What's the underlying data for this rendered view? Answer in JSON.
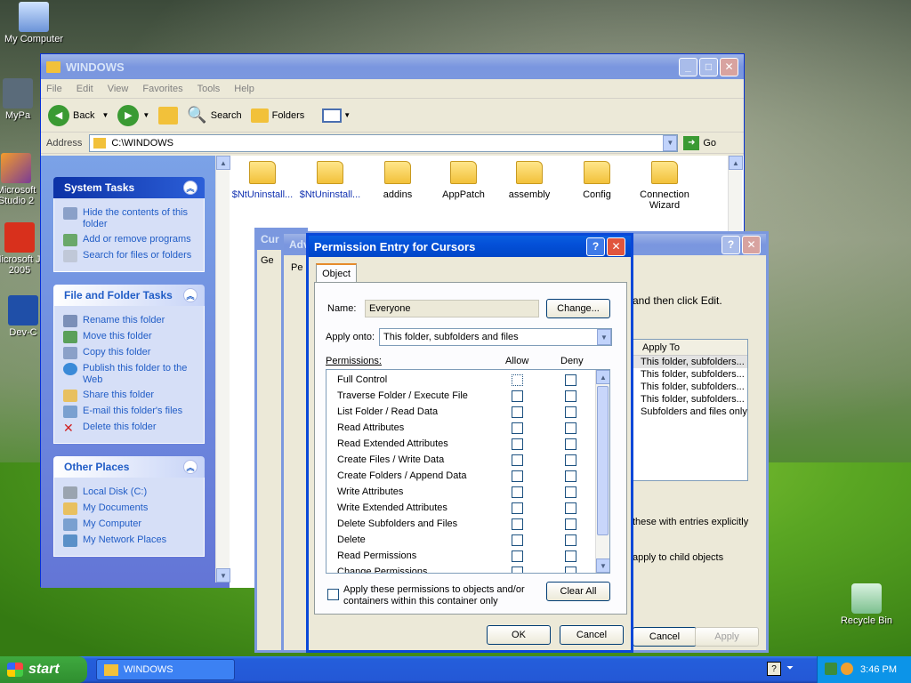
{
  "desktop": {
    "icons": [
      {
        "label": "My Computer"
      },
      {
        "label": "MyPa"
      },
      {
        "label": "Microsoft Studio 2"
      },
      {
        "label": "Microsoft J# 2005"
      },
      {
        "label": "Dev-C"
      },
      {
        "label": "Recycle Bin"
      }
    ]
  },
  "explorer": {
    "title": "WINDOWS",
    "menu": [
      "File",
      "Edit",
      "View",
      "Favorites",
      "Tools",
      "Help"
    ],
    "toolbar": {
      "back": "Back",
      "search": "Search",
      "folders": "Folders"
    },
    "address": {
      "label": "Address",
      "value": "C:\\WINDOWS",
      "go": "Go"
    },
    "system_tasks": {
      "title": "System Tasks",
      "items": [
        "Hide the contents of this folder",
        "Add or remove programs",
        "Search for files or folders"
      ]
    },
    "file_tasks": {
      "title": "File and Folder Tasks",
      "items": [
        "Rename this folder",
        "Move this folder",
        "Copy this folder",
        "Publish this folder to the Web",
        "Share this folder",
        "E-mail this folder's files",
        "Delete this folder"
      ]
    },
    "other_places": {
      "title": "Other Places",
      "items": [
        "Local Disk (C:)",
        "My Documents",
        "My Computer",
        "My Network Places"
      ]
    },
    "folders": [
      "$NtUninstall...",
      "$NtUninstall...",
      "addins",
      "AppPatch",
      "assembly",
      "Config",
      "Connection Wizard"
    ]
  },
  "background_dialogs": {
    "props_title": "Cur",
    "props_tab_general": "Ge",
    "adv_title": "Adv",
    "adv_tab": "Pe",
    "edit_hint": "and then click Edit.",
    "apply_to_header": "Apply To",
    "apply_to_rows": [
      "This folder, subfolders...",
      "This folder, subfolders...",
      "This folder, subfolders...",
      "This folder, subfolders...",
      "Subfolders and files only"
    ],
    "inherit_text": "these with entries explicitly",
    "child_text": "apply to child objects",
    "cancel": "Cancel",
    "apply": "Apply",
    "fragments": [
      "G",
      "T",
      "F",
      "F",
      "ms",
      "Pr",
      "sr",
      "F",
      "c"
    ]
  },
  "permission_dialog": {
    "title": "Permission Entry for Cursors",
    "tab": "Object",
    "name_label": "Name:",
    "name_value": "Everyone",
    "change_button": "Change...",
    "apply_onto_label": "Apply onto:",
    "apply_onto_value": "This folder, subfolders and files",
    "permissions_label": "Permissions:",
    "allow_header": "Allow",
    "deny_header": "Deny",
    "permissions": [
      "Full Control",
      "Traverse Folder / Execute File",
      "List Folder / Read Data",
      "Read Attributes",
      "Read Extended Attributes",
      "Create Files / Write Data",
      "Create Folders / Append Data",
      "Write Attributes",
      "Write Extended Attributes",
      "Delete Subfolders and Files",
      "Delete",
      "Read Permissions",
      "Change Permissions"
    ],
    "apply_within_text": "Apply these permissions to objects and/or containers within this container only",
    "clear_all": "Clear All",
    "ok": "OK",
    "cancel": "Cancel",
    "help_glyph": "?",
    "close_glyph": "✕"
  },
  "taskbar": {
    "start": "start",
    "task": "WINDOWS",
    "clock": "3:46 PM"
  },
  "colors": {
    "xp_blue": "#0a48d8",
    "task_link": "#215dc6",
    "start_green": "#3fa93f"
  }
}
